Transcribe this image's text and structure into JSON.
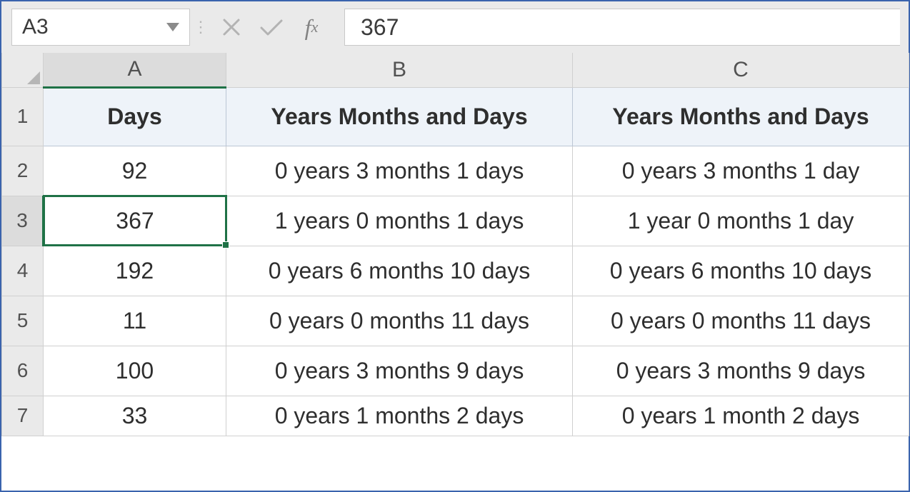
{
  "formula_bar": {
    "name_box": "A3",
    "formula_value": "367"
  },
  "columns": {
    "A": "A",
    "B": "B",
    "C": "C"
  },
  "headers": {
    "A": "Days",
    "B": "Years Months and Days",
    "C": "Years Months and Days"
  },
  "rows": [
    {
      "n": "1"
    },
    {
      "n": "2",
      "A": "92",
      "B": "0 years 3 months 1 days",
      "C": "0 years 3 months 1 day"
    },
    {
      "n": "3",
      "A": "367",
      "B": "1 years 0 months 1 days",
      "C": "1 year 0 months 1 day"
    },
    {
      "n": "4",
      "A": "192",
      "B": "0 years 6 months 10 days",
      "C": "0 years 6 months 10 days"
    },
    {
      "n": "5",
      "A": "11",
      "B": "0 years 0 months 11 days",
      "C": "0 years 0 months 11 days"
    },
    {
      "n": "6",
      "A": "100",
      "B": "0 years 3 months 9 days",
      "C": "0 years 3 months 9 days"
    },
    {
      "n": "7",
      "A": "33",
      "B": "0 years 1 months 2 days",
      "C": "0 years 1 month 2 days"
    }
  ],
  "selection": {
    "cell": "A3"
  },
  "chart_data": {
    "type": "table",
    "columns": [
      "Days",
      "Years Months and Days",
      "Years Months and Days"
    ],
    "rows": [
      [
        "92",
        "0 years 3 months 1 days",
        "0 years 3 months 1 day"
      ],
      [
        "367",
        "1 years 0 months 1 days",
        "1 year 0 months 1 day"
      ],
      [
        "192",
        "0 years 6 months 10 days",
        "0 years 6 months 10 days"
      ],
      [
        "11",
        "0 years 0 months 11 days",
        "0 years 0 months 11 days"
      ],
      [
        "100",
        "0 years 3 months 9 days",
        "0 years 3 months 9 days"
      ],
      [
        "33",
        "0 years 1 months 2 days",
        "0 years 1 month 2 days"
      ]
    ]
  }
}
